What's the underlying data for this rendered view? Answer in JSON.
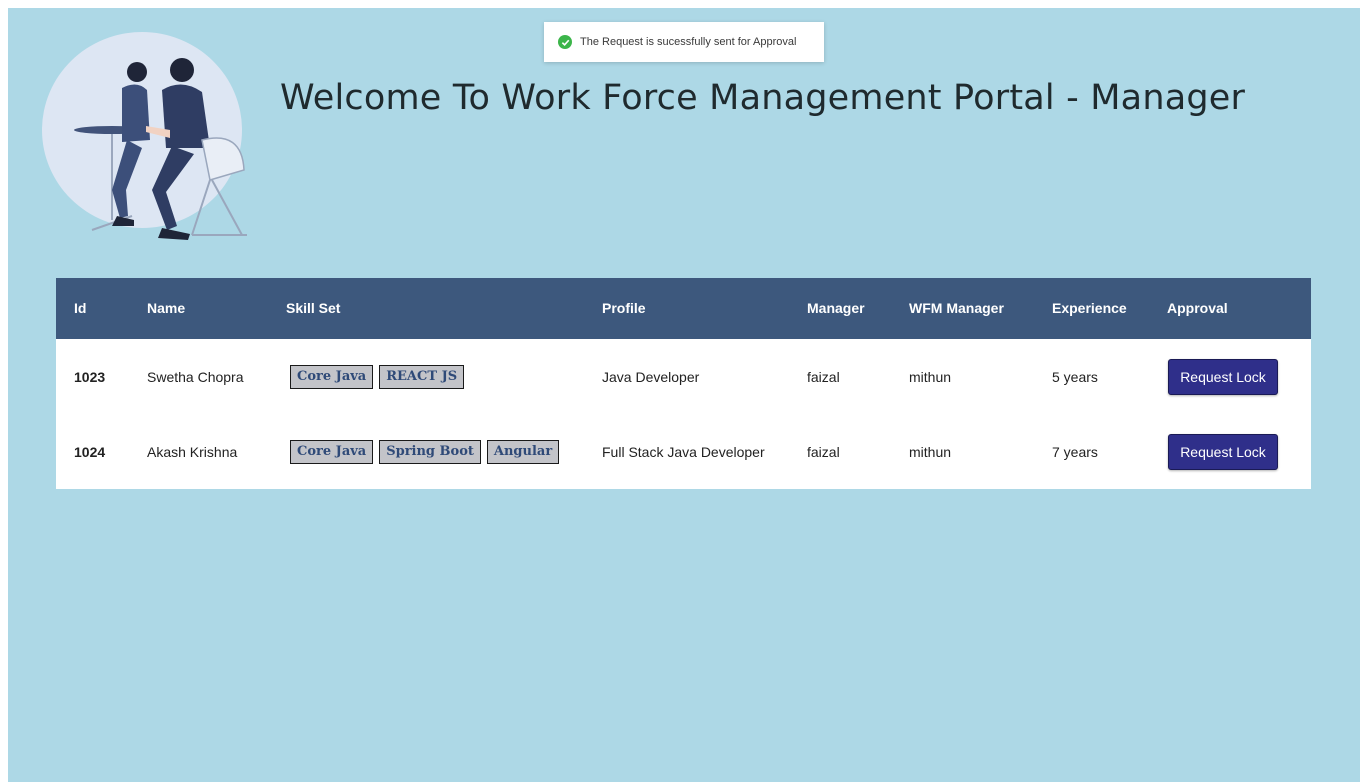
{
  "toast": {
    "message": "The Request is sucessfully sent for Approval",
    "icon": "check-circle-icon"
  },
  "header": {
    "title": "Welcome To Work Force Management Portal - Manager"
  },
  "table": {
    "columns": [
      "Id",
      "Name",
      "Skill Set",
      "Profile",
      "Manager",
      "WFM Manager",
      "Experience",
      "Approval"
    ],
    "rows": [
      {
        "id": "1023",
        "name": "Swetha Chopra",
        "skills": [
          "Core Java",
          "REACT JS"
        ],
        "profile": "Java Developer",
        "manager": "faizal",
        "wfm_manager": "mithun",
        "experience": "5 years",
        "action": "Request Lock"
      },
      {
        "id": "1024",
        "name": "Akash Krishna",
        "skills": [
          "Core Java",
          "Spring Boot",
          "Angular"
        ],
        "profile": "Full Stack Java Developer",
        "manager": "faizal",
        "wfm_manager": "mithun",
        "experience": "7 years",
        "action": "Request Lock"
      }
    ]
  },
  "colors": {
    "background": "#add8e6",
    "header_bar": "#3d587d",
    "button": "#2f2f8a",
    "chip": "#c3c4c9",
    "toast_check": "#3cb54a"
  }
}
